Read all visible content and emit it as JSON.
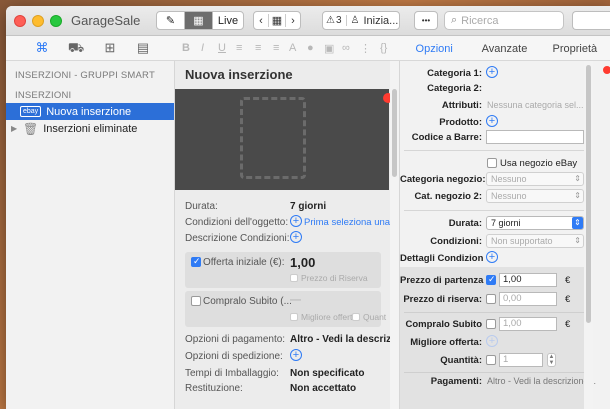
{
  "app": {
    "title": "GarageSale"
  },
  "toolbar": {
    "live_label": "Live",
    "alerts_count": "3",
    "status_label": "Inizia...",
    "more_label": "•••",
    "search_placeholder": "Ricerca"
  },
  "right_tabs": [
    "Opzioni",
    "Avanzate",
    "Proprietà"
  ],
  "sidebar": {
    "header_smart": "INSERZIONI - GRUPPI SMART",
    "header_listings": "INSERZIONI",
    "items": [
      {
        "label": "Nuova inserzione",
        "badge": "ebay"
      },
      {
        "label": "Inserzioni eliminate"
      }
    ]
  },
  "listing": {
    "title": "Nuova inserzione",
    "durata_label": "Durata:",
    "durata_value": "7 giorni",
    "condizioni_label": "Condizioni dell'oggetto:",
    "condizioni_link": "Prima seleziona una catego",
    "descr_label": "Descrizione Condizioni:",
    "offerta_label": "Offerta iniziale (€):",
    "offerta_value": "1,00",
    "prezzo_riserva": "Prezzo di Riserva",
    "compralo_label": "Compralo Subito (...",
    "compralo_value": "—",
    "migliore_offerta": "Migliore offerta",
    "quantita_short": "Quant",
    "pagamento_label": "Opzioni di pagamento:",
    "pagamento_value": "Altro - Vedi la descrizione",
    "spedizione_label": "Opzioni di spedizione:",
    "imballaggio_label": "Tempi di Imballaggio:",
    "imballaggio_value": "Non specificato",
    "restituzione_label": "Restituzione:",
    "restituzione_value": "Non accettato"
  },
  "options": {
    "categoria1": "Categoria 1:",
    "categoria2": "Categoria 2:",
    "attributi": "Attributi:",
    "attributi_value": "Nessuna categoria sel...",
    "prodotto": "Prodotto:",
    "codice_barre": "Codice a Barre:",
    "usa_negozio": "Usa negozio eBay",
    "cat_negozio": "Categoria negozio:",
    "cat_negozio_value": "Nessuno",
    "cat_negozio2": "Cat. negozio 2:",
    "cat_negozio2_value": "Nessuno",
    "durata": "Durata:",
    "durata_value": "7 giorni",
    "condizioni": "Condizioni:",
    "condizioni_value": "Non supportato",
    "dettagli_condizion": "Dettagli Condizion",
    "prezzo_partenza": "Prezzo di partenza",
    "prezzo_partenza_value": "1,00",
    "prezzo_riserva": "Prezzo di riserva:",
    "prezzo_riserva_value": "0,00",
    "compralo_subito": "Compralo Subito",
    "compralo_subito_value": "1,00",
    "migliore_offerta": "Migliore offerta:",
    "quantita": "Quantità:",
    "quantita_value": "1",
    "pagamenti": "Pagamenti:",
    "pagamenti_value": "Altro - Vedi la descrizione...",
    "currency": "€"
  },
  "colors": {
    "accent": "#2f7bf5",
    "selection": "#2c6fd8"
  }
}
